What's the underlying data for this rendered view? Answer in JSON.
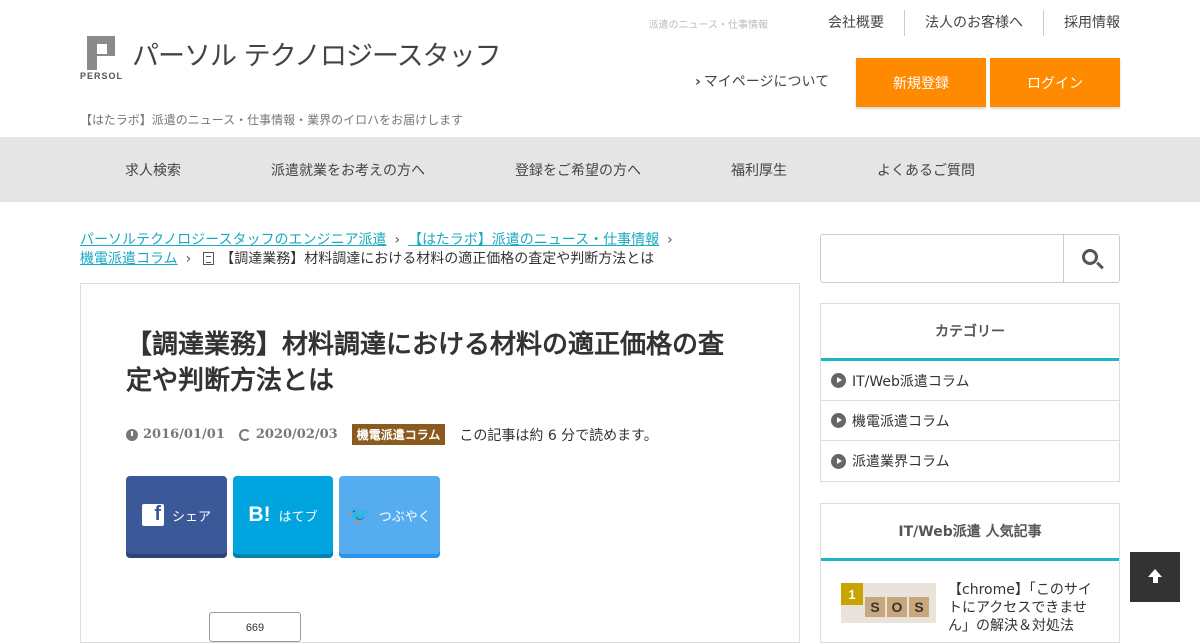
{
  "header": {
    "logo_text": "パーソル テクノロジースタッフ",
    "logo_mark_text": "PERSOL",
    "tagline": "【はたラボ】派遣のニュース・仕事情報・業界のイロハをお届けします",
    "small_link": "派遣のニュース・仕事情報",
    "top_links": [
      "会社概要",
      "法人のお客様へ",
      "採用情報"
    ],
    "mypage_label": "マイページについて",
    "register_label": "新規登録",
    "login_label": "ログイン"
  },
  "nav": {
    "items": [
      "求人検索",
      "派遣就業をお考えの方へ",
      "登録をご希望の方へ",
      "福利厚生",
      "よくあるご質問"
    ]
  },
  "breadcrumb": {
    "items": [
      "パーソルテクノロジースタッフのエンジニア派遣",
      "【はたラボ】派遣のニュース・仕事情報",
      "機電派遣コラム"
    ],
    "current": "【調達業務】材料調達における材料の適正価格の査定や判断方法とは"
  },
  "article": {
    "title": "【調達業務】材料調達における材料の適正価格の査定や判断方法とは",
    "published": "2016/01/01",
    "updated": "2020/02/03",
    "category": "機電派遣コラム",
    "read_time": "この記事は約 6 分で読めます。",
    "share": {
      "facebook_label": "シェア",
      "hatena_label": "はてブ",
      "twitter_label": "つぶやく",
      "facebook_icon": "f",
      "hatena_icon": "B!",
      "twitter_icon": "🐦"
    },
    "count": "669"
  },
  "sidebar": {
    "search_placeholder": "",
    "category_title": "カテゴリー",
    "categories": [
      "IT/Web派遣コラム",
      "機電派遣コラム",
      "派遣業界コラム"
    ],
    "popular_title": "IT/Web派遣 人気記事",
    "popular": [
      {
        "rank": "1",
        "title": "【chrome】「このサイトにアクセスできません」の解決＆対処法",
        "thumb_letters": [
          "S",
          "O",
          "S"
        ]
      }
    ]
  },
  "colors": {
    "accent_orange": "#ff8a00",
    "accent_teal": "#1cb5c5",
    "link": "#19a9c2",
    "category_badge": "#8a5a1e",
    "facebook": "#3b5998",
    "hatena": "#00a4de",
    "twitter": "#55acee"
  }
}
